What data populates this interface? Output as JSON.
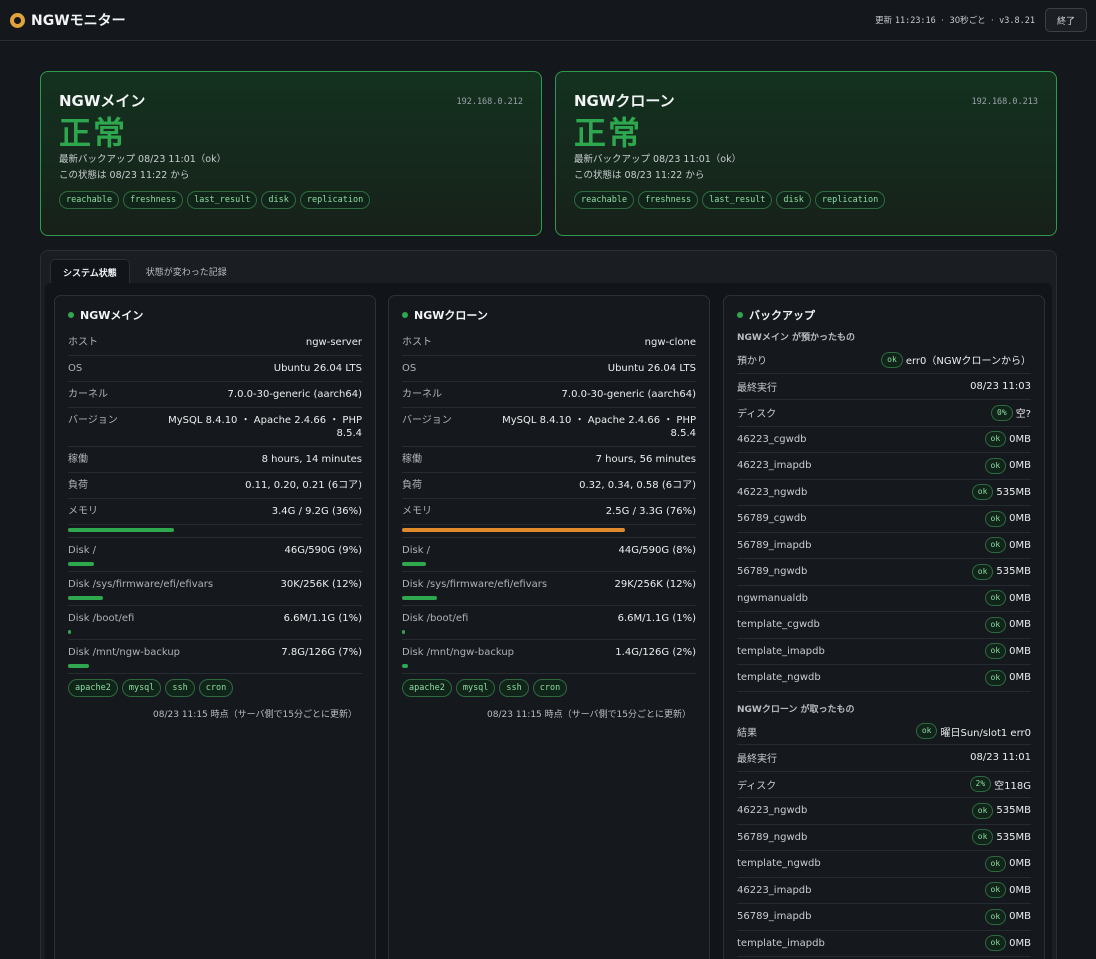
{
  "app": {
    "title": "NGWモニター",
    "updated_label": "更新",
    "updated_time": "11:23:16",
    "interval": "30秒ごと",
    "version": "v3.8.21",
    "quit_label": "終了",
    "sep": "·"
  },
  "nodes": [
    {
      "name": "NGWメイン",
      "ip": "192.168.0.212",
      "state": "正常",
      "last_backup": "最新バックアップ 08/23 11:01（ok）",
      "since": "この状態は 08/23 11:22 から",
      "tags": [
        "reachable",
        "freshness",
        "last_result",
        "disk",
        "replication"
      ]
    },
    {
      "name": "NGWクローン",
      "ip": "192.168.0.213",
      "state": "正常",
      "last_backup": "最新バックアップ 08/23 11:01（ok）",
      "since": "この状態は 08/23 11:22 から",
      "tags": [
        "reachable",
        "freshness",
        "last_result",
        "disk",
        "replication"
      ]
    }
  ],
  "tabs": [
    "システム状態",
    "状態が変わった記録"
  ],
  "systems": [
    {
      "title": "NGWメイン",
      "rows": [
        {
          "k": "ホスト",
          "v": "ngw-server"
        },
        {
          "k": "OS",
          "v": "Ubuntu 26.04 LTS"
        },
        {
          "k": "カーネル",
          "v": "7.0.0-30-generic (aarch64)"
        },
        {
          "k": "バージョン",
          "v": "MySQL 8.4.10 ・ Apache 2.4.66 ・ PHP 8.5.4"
        },
        {
          "k": "稼働",
          "v": "8 hours, 14 minutes"
        },
        {
          "k": "負荷",
          "v": "0.11, 0.20, 0.21 (6コア)"
        },
        {
          "k": "メモリ",
          "v": "3.4G / 9.2G (36%)"
        }
      ],
      "memory_pct": 36,
      "disks": [
        {
          "k": "Disk /",
          "v": "46G/590G (9%)",
          "pct": 9
        },
        {
          "k": "Disk /sys/firmware/efi/efivars",
          "v": "30K/256K (12%)",
          "pct": 12
        },
        {
          "k": "Disk /boot/efi",
          "v": "6.6M/1.1G (1%)",
          "pct": 1
        },
        {
          "k": "Disk /mnt/ngw-backup",
          "v": "7.8G/126G (7%)",
          "pct": 7
        }
      ],
      "services": [
        "apache2",
        "mysql",
        "ssh",
        "cron"
      ],
      "footnote": "08/23 11:15 時点（サーバ側で15分ごとに更新）"
    },
    {
      "title": "NGWクローン",
      "rows": [
        {
          "k": "ホスト",
          "v": "ngw-clone"
        },
        {
          "k": "OS",
          "v": "Ubuntu 26.04 LTS"
        },
        {
          "k": "カーネル",
          "v": "7.0.0-30-generic (aarch64)"
        },
        {
          "k": "バージョン",
          "v": "MySQL 8.4.10 ・ Apache 2.4.66 ・ PHP 8.5.4"
        },
        {
          "k": "稼働",
          "v": "7 hours, 56 minutes"
        },
        {
          "k": "負荷",
          "v": "0.32, 0.34, 0.58 (6コア)"
        },
        {
          "k": "メモリ",
          "v": "2.5G / 3.3G (76%)"
        }
      ],
      "memory_pct": 76,
      "disks": [
        {
          "k": "Disk /",
          "v": "44G/590G (8%)",
          "pct": 8
        },
        {
          "k": "Disk /sys/firmware/efi/efivars",
          "v": "29K/256K (12%)",
          "pct": 12
        },
        {
          "k": "Disk /boot/efi",
          "v": "6.6M/1.1G (1%)",
          "pct": 1
        },
        {
          "k": "Disk /mnt/ngw-backup",
          "v": "1.4G/126G (2%)",
          "pct": 2
        }
      ],
      "services": [
        "apache2",
        "mysql",
        "ssh",
        "cron"
      ],
      "footnote": "08/23 11:15 時点（サーバ側で15分ごとに更新）"
    }
  ],
  "backup": {
    "title": "バックアップ",
    "main_heading": "NGWメイン が預かったもの",
    "main_rows": [
      {
        "k": "預かり",
        "pill": "ok",
        "v": "err0（NGWクローンから）"
      },
      {
        "k": "最終実行",
        "pill": "",
        "v": "08/23 11:03"
      },
      {
        "k": "ディスク",
        "pill": "0%",
        "v": "空?"
      },
      {
        "k": "46223_cgwdb",
        "pill": "ok",
        "v": "0MB"
      },
      {
        "k": "46223_imapdb",
        "pill": "ok",
        "v": "0MB"
      },
      {
        "k": "46223_ngwdb",
        "pill": "ok",
        "v": "535MB"
      },
      {
        "k": "56789_cgwdb",
        "pill": "ok",
        "v": "0MB"
      },
      {
        "k": "56789_imapdb",
        "pill": "ok",
        "v": "0MB"
      },
      {
        "k": "56789_ngwdb",
        "pill": "ok",
        "v": "535MB"
      },
      {
        "k": "ngwmanualdb",
        "pill": "ok",
        "v": "0MB"
      },
      {
        "k": "template_cgwdb",
        "pill": "ok",
        "v": "0MB"
      },
      {
        "k": "template_imapdb",
        "pill": "ok",
        "v": "0MB"
      },
      {
        "k": "template_ngwdb",
        "pill": "ok",
        "v": "0MB"
      }
    ],
    "clone_heading": "NGWクローン が取ったもの",
    "clone_rows": [
      {
        "k": "結果",
        "pill": "ok",
        "v": "曜日Sun/slot1 err0"
      },
      {
        "k": "最終実行",
        "pill": "",
        "v": "08/23 11:01"
      },
      {
        "k": "ディスク",
        "pill": "2%",
        "v": "空118G"
      },
      {
        "k": "46223_ngwdb",
        "pill": "ok",
        "v": "535MB"
      },
      {
        "k": "56789_ngwdb",
        "pill": "ok",
        "v": "535MB"
      },
      {
        "k": "template_ngwdb",
        "pill": "ok",
        "v": "0MB"
      },
      {
        "k": "46223_imapdb",
        "pill": "ok",
        "v": "0MB"
      },
      {
        "k": "56789_imapdb",
        "pill": "ok",
        "v": "0MB"
      },
      {
        "k": "template_imapdb",
        "pill": "ok",
        "v": "0MB"
      }
    ]
  }
}
